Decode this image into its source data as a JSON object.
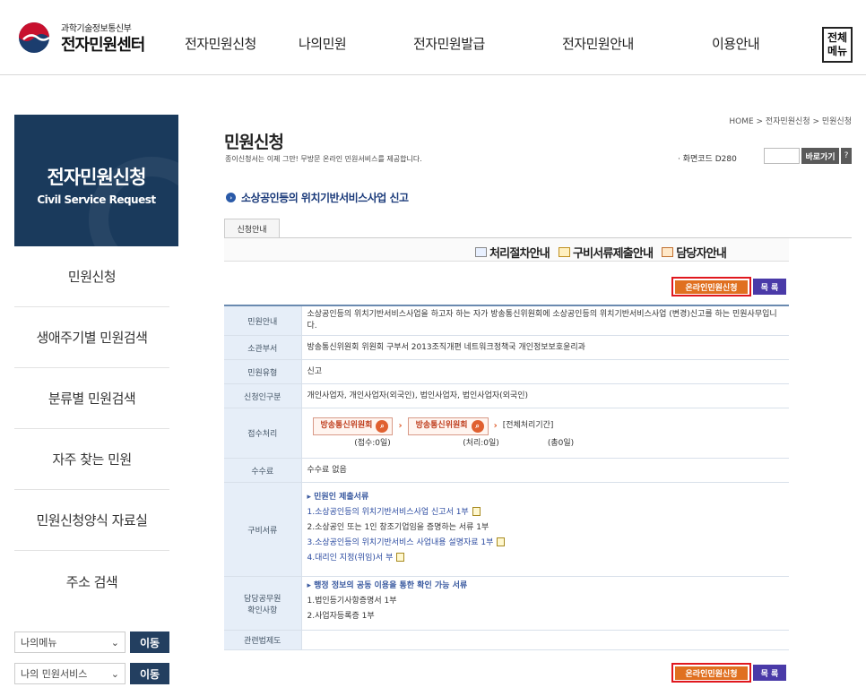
{
  "header": {
    "logo_sub": "과학기술정보통신부",
    "logo_main": "전자민원센터",
    "nav": [
      "전자민원신청",
      "나의민원",
      "전자민원발급",
      "전자민원안내",
      "이용안내"
    ],
    "all_menu": "전체\n메뉴"
  },
  "sidebar": {
    "title": "전자민원신청",
    "subtitle": "Civil Service Request",
    "items": [
      "민원신청",
      "생애주기별 민원검색",
      "분류별 민원검색",
      "자주 찾는 민원",
      "민원신청양식 자료실",
      "주소 검색"
    ],
    "selects": [
      {
        "value": "나의메뉴",
        "go": "이동"
      },
      {
        "value": "나의 민원서비스",
        "go": "이동"
      }
    ]
  },
  "main": {
    "breadcrumb": "HOME > 전자민원신청 > 민원신청",
    "title": "민원신청",
    "desc": "종이신청서는 이제 그만! 무방문 온라인 민원서비스를 제공합니다.",
    "screen_code_label": "· 화면코드  D280",
    "go_label": "바로가기",
    "help_label": "?",
    "subtitle": "소상공인등의 위치기반서비스사업 신고",
    "tab": "신청안내",
    "quicklinks": [
      "처리절차안내",
      "구비서류제출안내",
      "담당자안내"
    ],
    "online_btn": "온라인민원신청",
    "list_btn": "목 록"
  },
  "table": {
    "rows": {
      "guide": {
        "th": "민원안내",
        "td": "소상공인등의 위치기반서비스사업을 하고자 하는 자가 방송통신위원회에 소상공인등의 위치기반서비스사업 (변경)신고를 하는 민원사무입니다."
      },
      "dept": {
        "th": "소관부서",
        "td": "방송통신위원회 위원회 구부서 2013조직개편 네트워크정책국 개인정보보호윤리과"
      },
      "type": {
        "th": "민원유형",
        "td": "신고"
      },
      "applicant": {
        "th": "신청인구분",
        "td": "개인사업자, 개인사업자(외국인), 법인사업자, 법인사업자(외국인)"
      },
      "process": {
        "th": "접수처리",
        "box1": "방송통신위원회",
        "box2": "방송통신위원회",
        "total_label": "[전체처리기간]",
        "sub1": "(접수:0일)",
        "sub2": "(처리:0일)",
        "sub3": "(총0일)"
      },
      "fee": {
        "th": "수수료",
        "td": "수수료 없음"
      },
      "docs": {
        "th": "구비서류",
        "head": "▸ 민원인 제출서류",
        "items": [
          "1.소상공인등의 위치기반서비스사업 신고서 1부",
          "2.소상공인 또는 1인 창조기업임을 증명하는 서류 1부",
          "3.소상공인등의 위치기반서비스 사업내용 설명자료 1부",
          "4.대리인 지정(위임)서 부"
        ]
      },
      "officer": {
        "th": "담당공무원\n확인사항",
        "head": "▸ 행정 정보의 공동 이용을 통한 확인 가능 서류",
        "items": [
          "1.법인등기사항증명서 1부",
          "2.사업자등록증 1부"
        ]
      },
      "law": {
        "th": "관련법제도",
        "td": ""
      }
    }
  }
}
